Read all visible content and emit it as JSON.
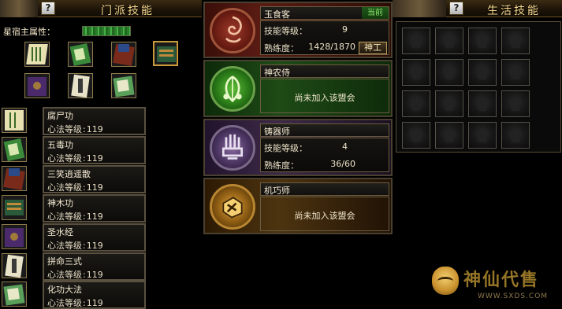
{
  "left_panel": {
    "help_label": "?",
    "title": "门派技能",
    "attribute_label": "星宿主属性：",
    "books": [
      {
        "name": "book-1",
        "icon": "scroll-icon",
        "selected": false
      },
      {
        "name": "book-2",
        "icon": "green-tome-icon",
        "selected": false
      },
      {
        "name": "book-3",
        "icon": "red-tome-icon",
        "selected": false
      },
      {
        "name": "book-4",
        "icon": "blue-tome-icon",
        "selected": true
      },
      {
        "name": "book-5",
        "icon": "purple-tome-icon",
        "selected": false
      },
      {
        "name": "book-6",
        "icon": "talisman-icon",
        "selected": false
      },
      {
        "name": "book-7",
        "icon": "jade-tome-icon",
        "selected": false
      }
    ],
    "skills": [
      {
        "name": "腐尸功",
        "level_label": "心法等级",
        "level": "119"
      },
      {
        "name": "五毒功",
        "level_label": "心法等级",
        "level": "119"
      },
      {
        "name": "三笑逍遥散",
        "level_label": "心法等级",
        "level": "119"
      },
      {
        "name": "神木功",
        "level_label": "心法等级",
        "level": "119"
      },
      {
        "name": "圣水经",
        "level_label": "心法等级",
        "level": "119"
      },
      {
        "name": "拼命三式",
        "level_label": "心法等级",
        "level": "119"
      },
      {
        "name": "化功大法",
        "level_label": "心法等级",
        "level": "119"
      }
    ]
  },
  "professions": {
    "cook": {
      "name": "玉食客",
      "current_tag": "当前",
      "skill_level_label": "技能等级：",
      "skill_level": "9",
      "proficiency_label": "熟练度：",
      "proficiency": "1428/1870",
      "rank_button": "神工",
      "icon": "dragon-emblem-icon"
    },
    "herbalist": {
      "name": "神农侍",
      "status": "尚未加入该盟会",
      "icon": "leaf-emblem-icon"
    },
    "smith": {
      "name": "铸器师",
      "skill_level_label": "技能等级：",
      "skill_level": "4",
      "proficiency_label": "熟练度：",
      "proficiency": "36/60",
      "icon": "forge-emblem-icon"
    },
    "mechanic": {
      "name": "机巧师",
      "status": "尚未加入该盟会",
      "icon": "gear-emblem-icon"
    }
  },
  "right_panel": {
    "help_label": "?",
    "title": "生活技能",
    "slot_count": 16
  },
  "watermark": {
    "brand": "神仙代售",
    "url": "WWW.SXDS.COM"
  },
  "colors": {
    "gold_title": "#f3d58c",
    "current_green": "#8fe56d",
    "panel_border": "#5a5040"
  }
}
